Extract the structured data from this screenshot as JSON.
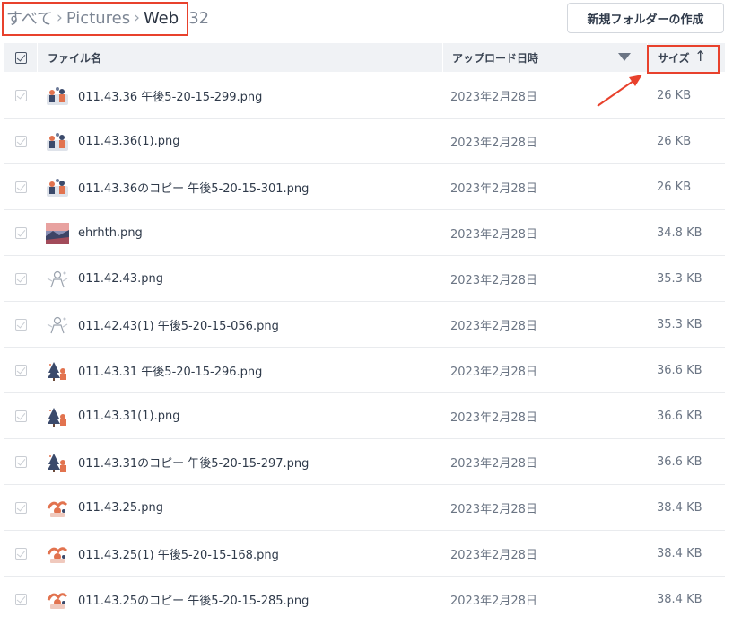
{
  "breadcrumb": {
    "root": "すべて",
    "parent": "Pictures",
    "current": "Web",
    "count": "32",
    "separator": "›"
  },
  "toolbar": {
    "new_folder_label": "新規フォルダーの作成"
  },
  "table": {
    "columns": {
      "name": "ファイル名",
      "uploaded": "アップロード日時",
      "size": "サイズ"
    },
    "sort_indicator": "↑",
    "rows": [
      {
        "name": "011.43.36 午後5-20-15-299.png",
        "date": "2023年2月28日",
        "size": "26 KB",
        "thumb": "people-illustration"
      },
      {
        "name": "011.43.36(1).png",
        "date": "2023年2月28日",
        "size": "26 KB",
        "thumb": "people-illustration"
      },
      {
        "name": "011.43.36のコピー 午後5-20-15-301.png",
        "date": "2023年2月28日",
        "size": "26 KB",
        "thumb": "people-illustration"
      },
      {
        "name": "ehrhth.png",
        "date": "2023年2月28日",
        "size": "34.8 KB",
        "thumb": "photo"
      },
      {
        "name": "011.42.43.png",
        "date": "2023年2月28日",
        "size": "35.3 KB",
        "thumb": "sketch-illustration"
      },
      {
        "name": "011.42.43(1) 午後5-20-15-056.png",
        "date": "2023年2月28日",
        "size": "35.3 KB",
        "thumb": "sketch-illustration"
      },
      {
        "name": "011.43.31 午後5-20-15-296.png",
        "date": "2023年2月28日",
        "size": "36.6 KB",
        "thumb": "tree-illustration"
      },
      {
        "name": "011.43.31(1).png",
        "date": "2023年2月28日",
        "size": "36.6 KB",
        "thumb": "tree-illustration"
      },
      {
        "name": "011.43.31のコピー 午後5-20-15-297.png",
        "date": "2023年2月28日",
        "size": "36.6 KB",
        "thumb": "tree-illustration"
      },
      {
        "name": "011.43.25.png",
        "date": "2023年2月28日",
        "size": "38.4 KB",
        "thumb": "red-illustration"
      },
      {
        "name": "011.43.25(1) 午後5-20-15-168.png",
        "date": "2023年2月28日",
        "size": "38.4 KB",
        "thumb": "red-illustration"
      },
      {
        "name": "011.43.25のコピー 午後5-20-15-285.png",
        "date": "2023年2月28日",
        "size": "38.4 KB",
        "thumb": "red-illustration"
      }
    ]
  },
  "colors": {
    "annotation": "#e8412c",
    "header_bg": "#f0f2f5"
  }
}
